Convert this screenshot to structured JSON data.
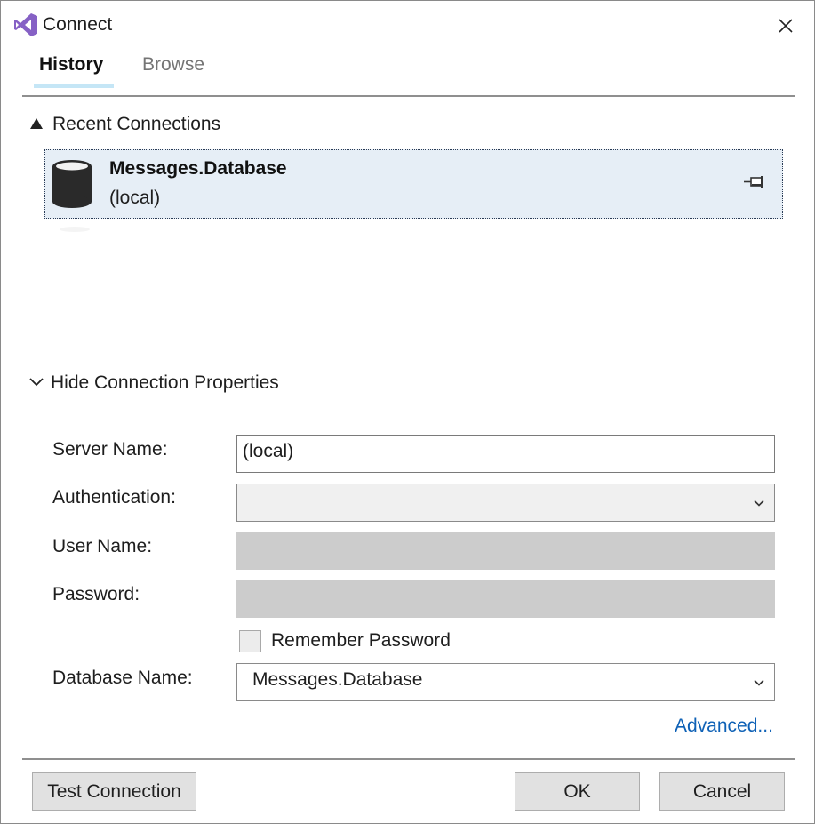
{
  "window": {
    "title": "Connect",
    "icon": "visual-studio-icon"
  },
  "tabs": [
    {
      "label": "History",
      "active": true
    },
    {
      "label": "Browse",
      "active": false
    }
  ],
  "recent": {
    "header": "Recent Connections",
    "items": [
      {
        "name": "Messages.Database",
        "server": "(local)",
        "icon": "database-icon",
        "pin_icon": "pin-icon"
      }
    ]
  },
  "properties": {
    "toggle_label": "Hide Connection Properties",
    "server_name": {
      "label": "Server Name:",
      "value": "(local)"
    },
    "authentication": {
      "label": "Authentication:",
      "value": ""
    },
    "user_name": {
      "label": "User Name:",
      "value": ""
    },
    "password": {
      "label": "Password:",
      "value": ""
    },
    "remember_password": {
      "label": "Remember Password",
      "checked": false
    },
    "database_name": {
      "label": "Database Name:",
      "value": "Messages.Database"
    },
    "advanced_link": "Advanced..."
  },
  "buttons": {
    "test_connection": "Test Connection",
    "ok": "OK",
    "cancel": "Cancel"
  },
  "colors": {
    "selected_row": "#e6eef6",
    "tab_underline": "#c5e6f6",
    "link": "#0e61b6",
    "vs_purple": "#8661c5"
  }
}
